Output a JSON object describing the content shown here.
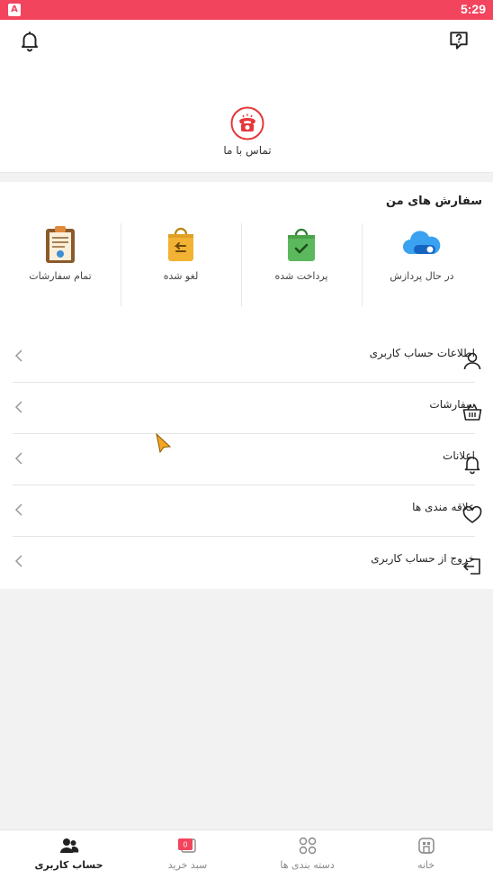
{
  "status_bar": {
    "time": "5:29",
    "app_badge": "A"
  },
  "header": {
    "contact_label": "تماس با ما"
  },
  "orders": {
    "title": "سفارش های من",
    "statuses": [
      {
        "label": "در حال پردازش",
        "icon": "cloud-toggle-icon"
      },
      {
        "label": "پرداخت شده",
        "icon": "paid-bag-icon"
      },
      {
        "label": "لغو شده",
        "icon": "cancelled-bag-icon"
      },
      {
        "label": "تمام سفارشات",
        "icon": "clipboard-icon"
      }
    ]
  },
  "menu": [
    {
      "label": "اطلاعات حساب کاربری",
      "icon": "user-icon"
    },
    {
      "label": "سفارشات",
      "icon": "basket-icon"
    },
    {
      "label": "اعلانات",
      "icon": "bell-icon"
    },
    {
      "label": "علاقه مندی ها",
      "icon": "heart-icon"
    },
    {
      "label": "خروج از حساب کاربری",
      "icon": "logout-icon"
    }
  ],
  "bottom_nav": [
    {
      "label": "خانه",
      "icon": "home-icon",
      "active": false
    },
    {
      "label": "دسته بندی ها",
      "icon": "grid-icon",
      "active": false
    },
    {
      "label": "سبد خرید",
      "icon": "cart-icon",
      "active": false,
      "badge": "0"
    },
    {
      "label": "حساب کاربری",
      "icon": "users-icon",
      "active": true
    }
  ],
  "colors": {
    "accent": "#f3445e",
    "phone": "#e5383b",
    "paid": "#4caf50",
    "cancelled": "#f2b233",
    "processing": "#2196f3"
  }
}
